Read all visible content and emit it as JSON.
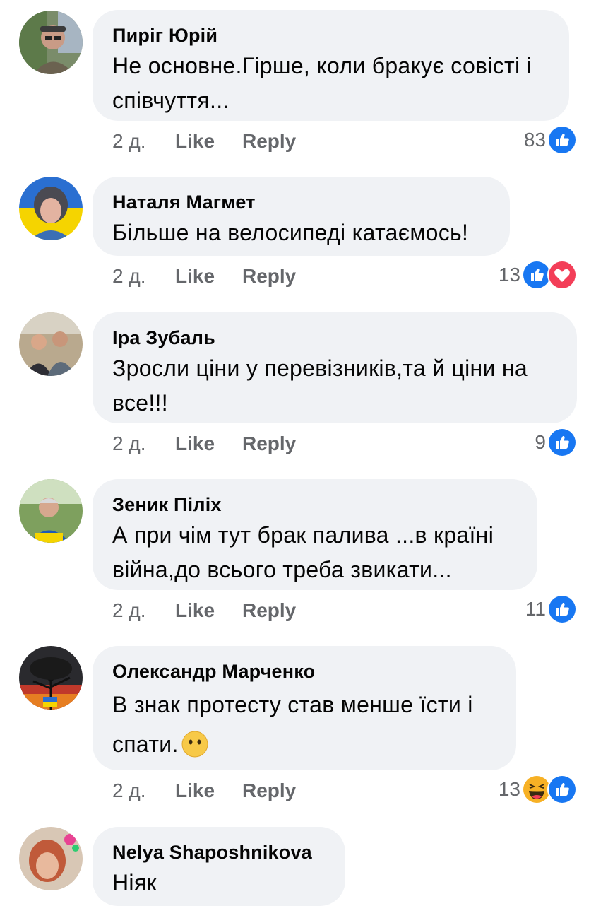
{
  "comments": [
    {
      "author": "Пиріг Юрій",
      "text": "Не основне.Гірше, коли бракує совісті і співчуття...",
      "time": "2 д.",
      "like_label": "Like",
      "reply_label": "Reply",
      "reaction_count": "83",
      "reactions": [
        "like-icon"
      ]
    },
    {
      "author": "Наталя Магмет",
      "text": "Більше на велосипеді катаємось!",
      "time": "2 д.",
      "like_label": "Like",
      "reply_label": "Reply",
      "reaction_count": "13",
      "reactions": [
        "like-icon",
        "love-icon"
      ]
    },
    {
      "author": "Іра Зубаль",
      "text": "Зросли ціни у перевізників,та й ціни на все!!!",
      "time": "2 д.",
      "like_label": "Like",
      "reply_label": "Reply",
      "reaction_count": "9",
      "reactions": [
        "like-icon"
      ]
    },
    {
      "author": "Зеник Пiлiх",
      "text": "А при чім тут брак палива ...в країні війна,до всього треба звикати...",
      "time": "2 д.",
      "like_label": "Like",
      "reply_label": "Reply",
      "reaction_count": "11",
      "reactions": [
        "like-icon"
      ]
    },
    {
      "author": "Олександр Марченко",
      "text": "В знак протесту став менше їсти і спати.",
      "text_emoji": "speechless-face-emoji",
      "time": "2 д.",
      "like_label": "Like",
      "reply_label": "Reply",
      "reaction_count": "13",
      "reactions": [
        "haha-icon",
        "like-icon"
      ]
    },
    {
      "author": "Nelya Shaposhnikova",
      "text": "Ніяк"
    }
  ],
  "colors": {
    "bubble": "#f0f2f5",
    "meta_text": "#65676b",
    "like_blue": "#1877f2",
    "love_red": "#f33e58",
    "haha_yellow": "#f7b125"
  }
}
